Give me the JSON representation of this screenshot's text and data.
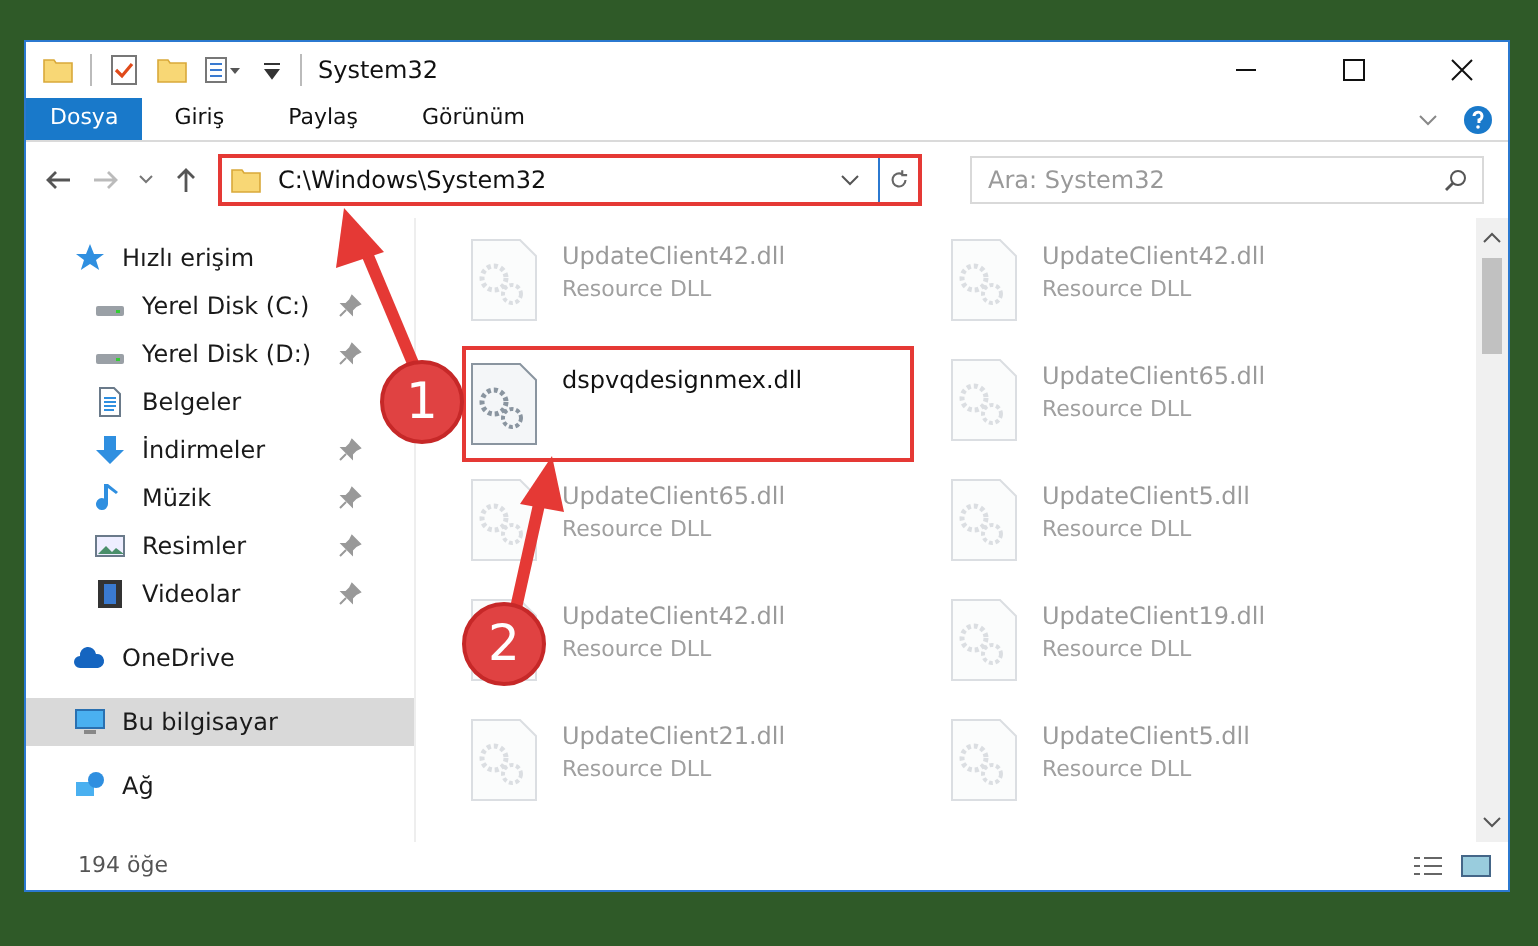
{
  "window": {
    "title": "System32"
  },
  "ribbon_tabs": [
    {
      "label": "Dosya",
      "kind": "file",
      "selected": false
    },
    {
      "label": "Giriş",
      "kind": "tab",
      "selected": false
    },
    {
      "label": "Paylaş",
      "kind": "tab",
      "selected": false
    },
    {
      "label": "Görünüm",
      "kind": "tab",
      "selected": false
    }
  ],
  "address": {
    "path": "C:\\Windows\\System32",
    "highlighted": true
  },
  "search": {
    "placeholder": "Ara: System32"
  },
  "sidebar": {
    "items": [
      {
        "label": "Hızlı erişim",
        "kind": "star",
        "selected": false,
        "children": [
          {
            "label": "Yerel Disk (C:)",
            "kind": "drive",
            "pinned": true,
            "selected": false
          },
          {
            "label": "Yerel Disk (D:)",
            "kind": "drive",
            "pinned": true,
            "selected": false
          },
          {
            "label": "Belgeler",
            "kind": "document",
            "pinned": false,
            "selected": false
          },
          {
            "label": "İndirmeler",
            "kind": "download",
            "pinned": true,
            "selected": false
          },
          {
            "label": "Müzik",
            "kind": "music",
            "pinned": true,
            "selected": false
          },
          {
            "label": "Resimler",
            "kind": "picture",
            "pinned": true,
            "selected": false
          },
          {
            "label": "Videolar",
            "kind": "video",
            "pinned": true,
            "selected": false
          }
        ]
      },
      {
        "label": "OneDrive",
        "kind": "cloud",
        "selected": false
      },
      {
        "label": "Bu bilgisayar",
        "kind": "computer",
        "selected": true
      },
      {
        "label": "Ağ",
        "kind": "network",
        "selected": false
      }
    ]
  },
  "files": [
    {
      "name": "UpdateClient42.dll",
      "type": "Resource DLL",
      "highlighted": false
    },
    {
      "name": "UpdateClient42.dll",
      "type": "Resource DLL",
      "highlighted": false
    },
    {
      "name": "dspvqdesignmex.dll",
      "highlighted": true
    },
    {
      "name": "UpdateClient65.dll",
      "type": "Resource DLL",
      "highlighted": false
    },
    {
      "name": "UpdateClient65.dll",
      "type": "Resource DLL",
      "highlighted": false
    },
    {
      "name": "UpdateClient5.dll",
      "type": "Resource DLL",
      "highlighted": false
    },
    {
      "name": "UpdateClient42.dll",
      "type": "Resource DLL",
      "highlighted": false
    },
    {
      "name": "UpdateClient19.dll",
      "type": "Resource DLL",
      "highlighted": false
    },
    {
      "name": "UpdateClient21.dll",
      "type": "Resource DLL",
      "highlighted": false
    },
    {
      "name": "UpdateClient5.dll",
      "type": "Resource DLL",
      "highlighted": false
    }
  ],
  "status_bar": {
    "count": "194 öğe"
  },
  "annotations": [
    {
      "label": "1"
    },
    {
      "label": "2"
    }
  ]
}
